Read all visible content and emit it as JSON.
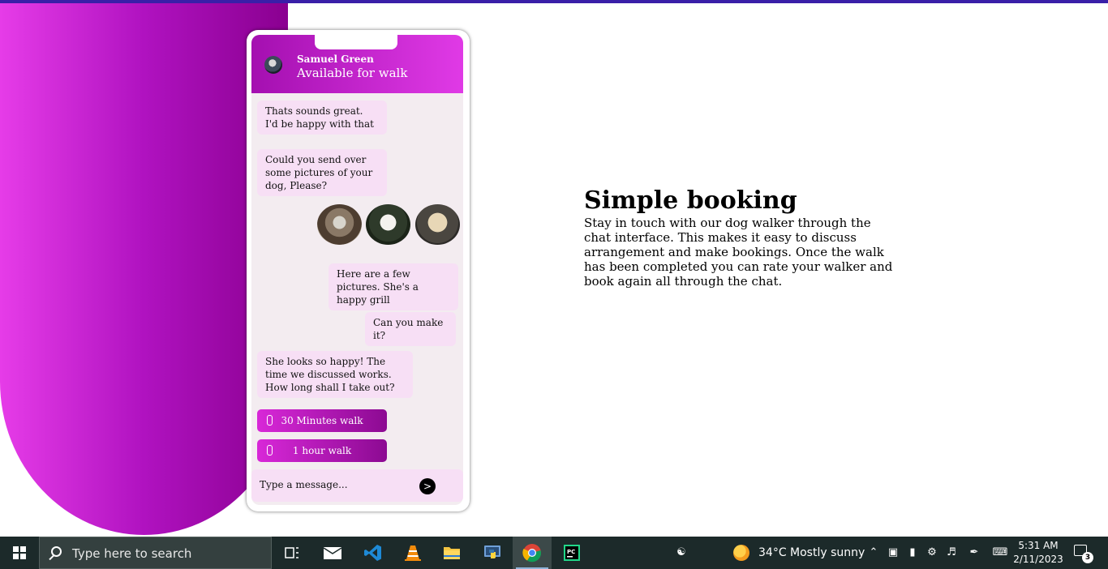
{
  "chat": {
    "contact_name": "Samuel Green",
    "contact_status": "Available for walk",
    "messages": [
      "Thats sounds great. I'd be happy with that",
      "Could you send over some pictures of your dog, Please?",
      "Here are a few pictures. She's a happy grill",
      "Can you make it?",
      "She looks so happy! The time we discussed works. How long shall I take out?"
    ],
    "options": [
      "30 Minutes walk",
      "1 hour walk"
    ],
    "input_placeholder": "Type a message...",
    "send_label": ">"
  },
  "feature": {
    "title": "Simple booking",
    "description": "Stay in touch with our dog walker through the chat interface. This makes it easy to discuss arrangement and make bookings. Once the walk has been completed you can rate your walker and book again all through the chat."
  },
  "taskbar": {
    "search_placeholder": "Type here to search",
    "weather": "34°C  Mostly sunny",
    "time": "5:31 AM",
    "date": "2/11/2023",
    "notification_count": "3",
    "apps": [
      "task-view",
      "mail",
      "vscode",
      "vlc",
      "file-explorer",
      "python",
      "chrome",
      "pycharm"
    ]
  },
  "colors": {
    "accent_magenta": "#e03ae6",
    "accent_purple": "#8c0a92",
    "bubble": "#f7dff5",
    "chat_bg": "#f3ecf0"
  }
}
